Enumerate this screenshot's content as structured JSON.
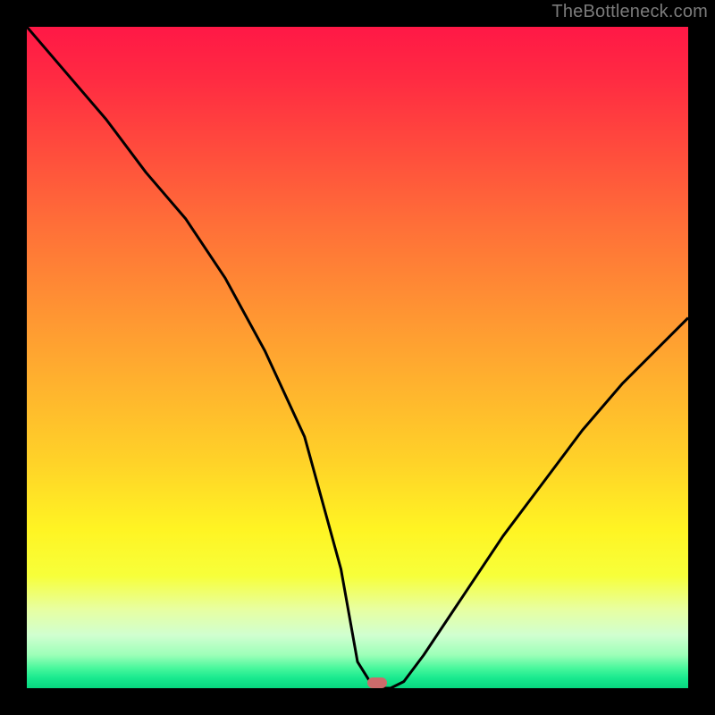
{
  "watermark": "TheBottleneck.com",
  "chart_data": {
    "type": "line",
    "title": "",
    "xlabel": "",
    "ylabel": "",
    "xlim": [
      0,
      100
    ],
    "ylim": [
      0,
      100
    ],
    "grid": false,
    "series": [
      {
        "name": "curve",
        "x": [
          0,
          6,
          12,
          18,
          24,
          30,
          36,
          42,
          47.5,
          50,
          52.5,
          55,
          57,
          60,
          66,
          72,
          78,
          84,
          90,
          96,
          100
        ],
        "values": [
          100,
          93,
          86,
          78,
          71,
          62,
          51,
          38,
          18,
          4,
          0,
          0,
          1,
          5,
          14,
          23,
          31,
          39,
          46,
          52,
          56
        ]
      }
    ],
    "marker": {
      "x": 53,
      "y": 0.8
    },
    "background_gradient": {
      "type": "vertical",
      "stops": [
        {
          "pos": 0,
          "color": "#ff1846"
        },
        {
          "pos": 0.5,
          "color": "#ffb22e"
        },
        {
          "pos": 0.8,
          "color": "#fff423"
        },
        {
          "pos": 1.0,
          "color": "#07d77f"
        }
      ]
    }
  }
}
